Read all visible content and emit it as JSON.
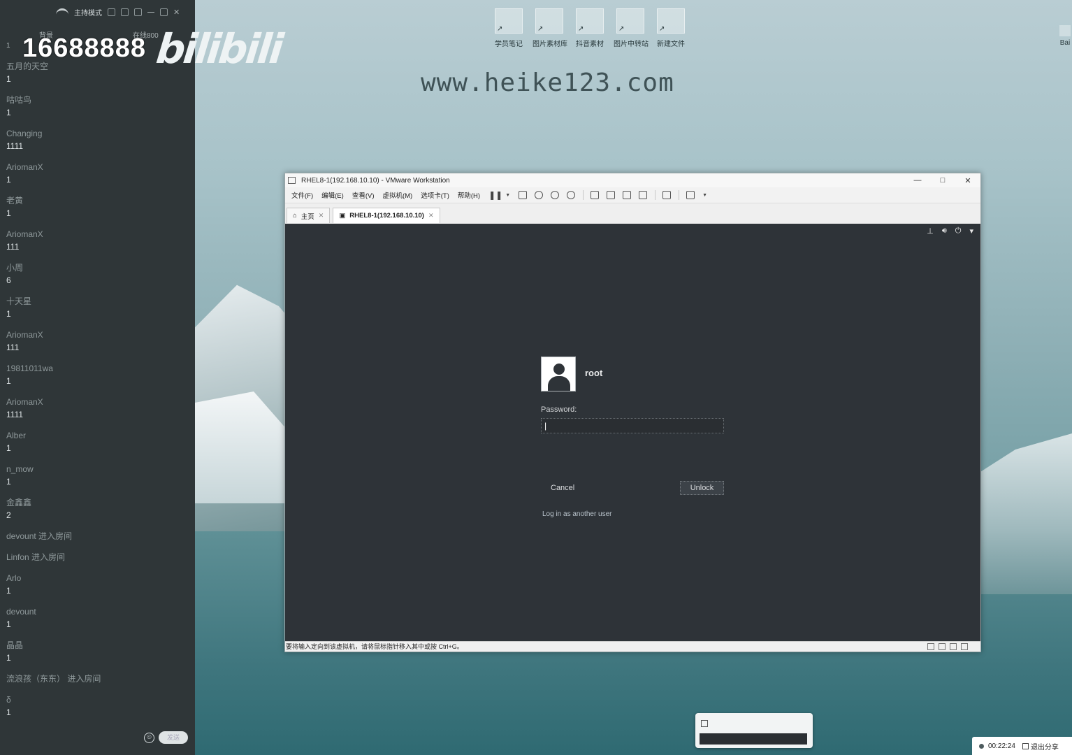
{
  "chat": {
    "mode_label": "主持模式",
    "header_left": "背景",
    "header_right": "在线800",
    "room_number": "16688888",
    "logo_text": "bilibili",
    "top_count": "1",
    "messages": [
      {
        "user": "五月的天空",
        "text": "1"
      },
      {
        "user": "咕咕鸟",
        "text": "1"
      },
      {
        "user": "Changing",
        "text": "1111"
      },
      {
        "user": "AriomanX",
        "text": "1"
      },
      {
        "user": "老黄",
        "text": "1"
      },
      {
        "user": "AriomanX",
        "text": "111"
      },
      {
        "user": "小周",
        "text": "6"
      },
      {
        "user": "十天星",
        "text": "1"
      },
      {
        "user": "AriomanX",
        "text": "111"
      },
      {
        "user": "19811011wa",
        "text": "1"
      },
      {
        "user": "AriomanX",
        "text": "1111"
      },
      {
        "user": "Alber",
        "text": "1"
      },
      {
        "user": "n_mow",
        "text": "1"
      },
      {
        "user": "金鑫鑫",
        "text": "2"
      }
    ],
    "enter1": "devount 进入房间",
    "enter2": "Linfon 进入房间",
    "messages2": [
      {
        "user": "Arlo",
        "text": "1"
      },
      {
        "user": "devount",
        "text": "1"
      },
      {
        "user": "晶晶",
        "text": "1"
      }
    ],
    "enter3": "流浪孩（东东） 进入房间",
    "last": {
      "user": "δ",
      "text": "1"
    },
    "send_label": "发送"
  },
  "desktop": {
    "watermark": "www.heike123.com",
    "icons": [
      "学员笔记",
      "图片素材库",
      "抖音素材",
      "图片中转站",
      "新建文件"
    ],
    "right_icon": "Bai"
  },
  "vmware": {
    "title": "RHEL8-1(192.168.10.10) - VMware Workstation",
    "menu": [
      "文件(F)",
      "编辑(E)",
      "查看(V)",
      "虚拟机(M)",
      "选项卡(T)",
      "帮助(H)"
    ],
    "tab_home": "主页",
    "tab_vm": "RHEL8-1(192.168.10.10)",
    "status_text": "要将输入定向到该虚拟机，请将鼠标指针移入其中或按 Ctrl+G。"
  },
  "login": {
    "username": "root",
    "password_label": "Password:",
    "password_value": "|",
    "cancel": "Cancel",
    "unlock": "Unlock",
    "another_user": "Log in as another user"
  },
  "tray": {
    "timer": "00:22:24",
    "exit_share": "退出分享"
  }
}
